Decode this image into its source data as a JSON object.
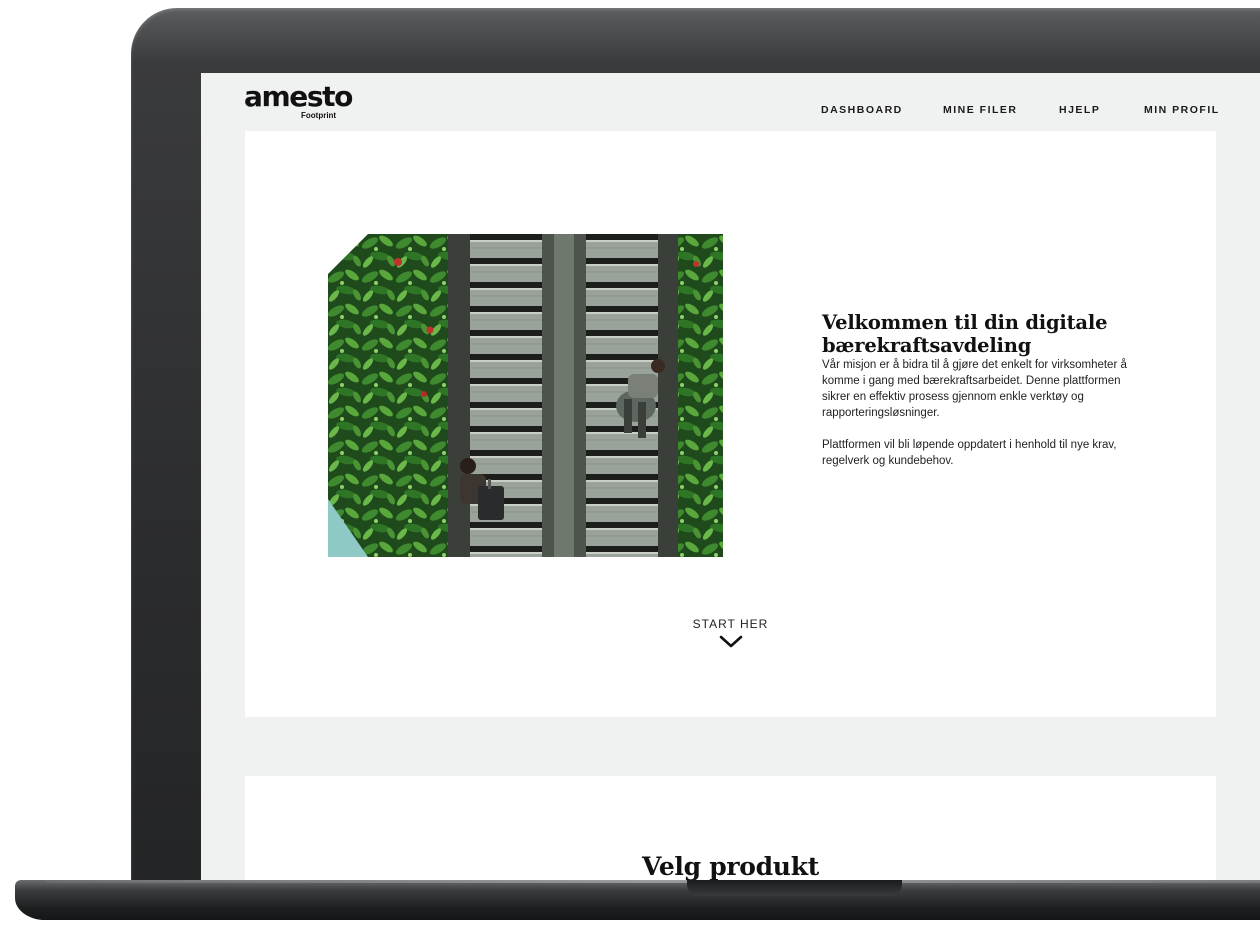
{
  "brand": {
    "name": "amesto",
    "product": "Footprint"
  },
  "nav": {
    "items": [
      {
        "label": "DASHBOARD"
      },
      {
        "label": "MINE FILER"
      },
      {
        "label": "HJELP"
      },
      {
        "label": "MIN PROFIL"
      }
    ]
  },
  "hero": {
    "title": "Velkommen til din digitale bærekraftsavdeling",
    "paragraphs": [
      "Vår misjon er å bidra til å gjøre det enkelt for virksomheter å komme i gang med bærekraftsarbeidet. Denne plattformen sikrer en effektiv prosess gjennom enkle verktøy og rapporteringsløsninger.",
      "Plattformen vil bli løpende oppdatert i henhold til nye krav, regelverk og kundebehov."
    ],
    "image_subject": "escalators-with-green-plant-wall",
    "cta_label": "START HER",
    "cta_icon": "chevron-down-icon"
  },
  "section2": {
    "title": "Velg produkt"
  },
  "colors": {
    "page_background": "#f0f2f1",
    "card_background": "#ffffff",
    "text": "#111111"
  }
}
